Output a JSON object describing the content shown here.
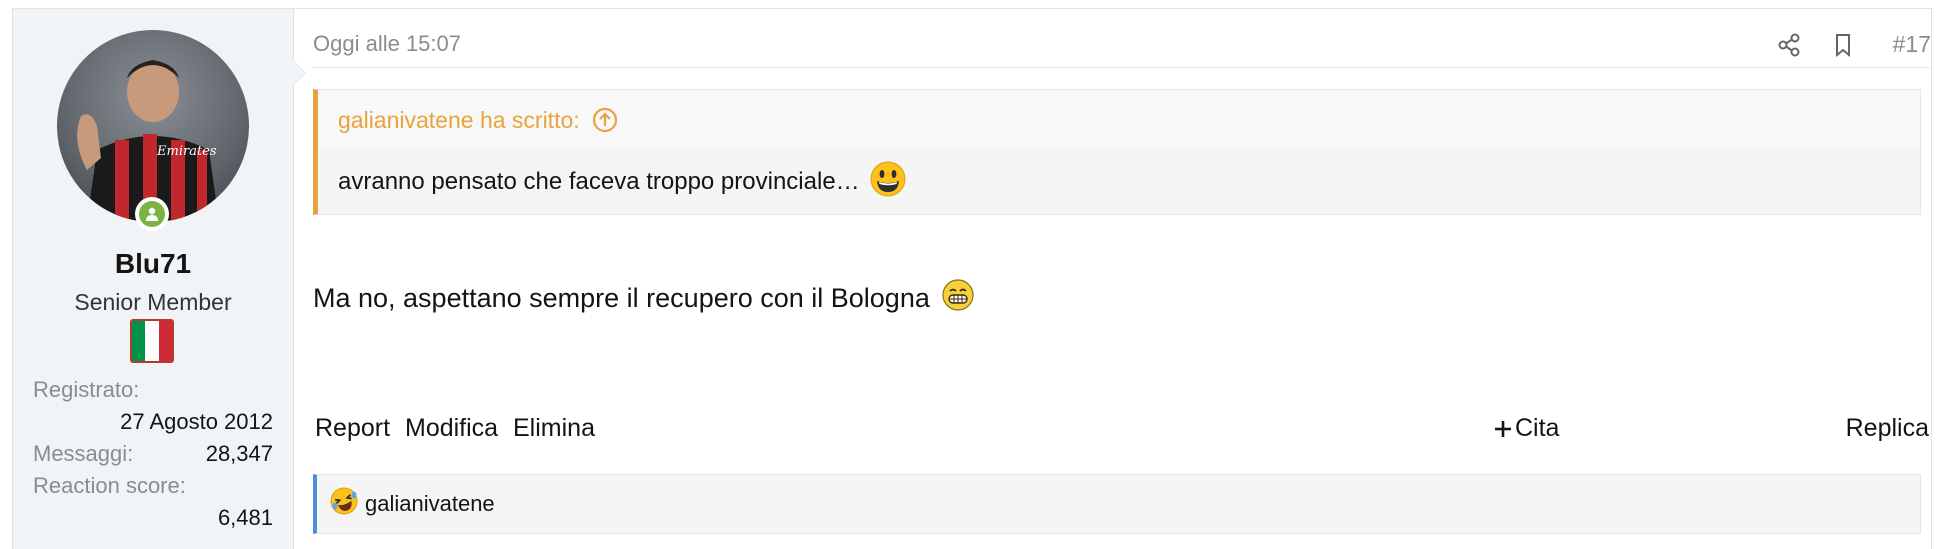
{
  "user": {
    "name": "Blu71",
    "title": "Senior Member",
    "stats": [
      {
        "label": "Registrato:",
        "value": "27 Agosto 2012"
      },
      {
        "label": "Messaggi:",
        "value": "28,347"
      },
      {
        "label": "Reaction score:",
        "value": "6,481"
      }
    ],
    "avatar_icon": "user-avatar-photo",
    "online_status_icon": "online-user-icon",
    "flag_colors": [
      "#009246",
      "#ffffff",
      "#ce2b37"
    ]
  },
  "post": {
    "timestamp": "Oggi alle 15:07",
    "number": "#17",
    "quote": {
      "author_line": "galianivatene ha scritto:",
      "text": "avranno pensato che faceva troppo provinciale…"
    },
    "body": "Ma no, aspettano sempre il recupero con il Bologna",
    "actions": {
      "report": "Report",
      "edit": "Modifica",
      "delete": "Elimina",
      "quote": "Cita",
      "reply": "Replica"
    },
    "reactions": {
      "users": "galianivatene",
      "icon": "laughing-emoji-icon"
    }
  },
  "colors": {
    "quote_accent": "#e8a33c",
    "reaction_accent": "#4a90d9",
    "sidebar_bg": "#f0f4f7",
    "online_green": "#7cb342"
  }
}
